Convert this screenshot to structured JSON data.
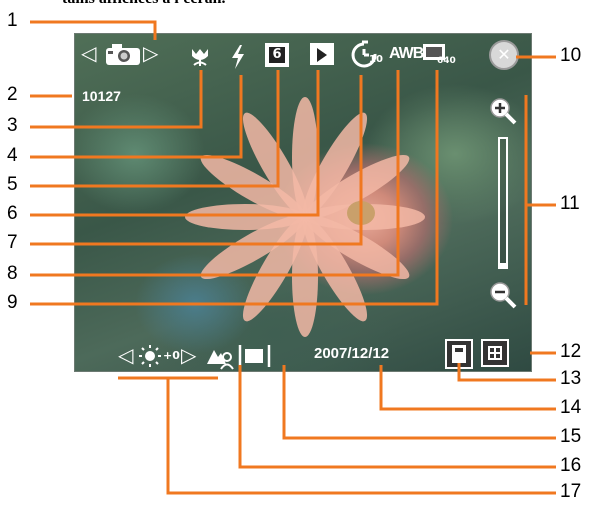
{
  "header": {
    "caption": "tains affichées à l'écran."
  },
  "screen": {
    "shot_counter": "10127",
    "white_balance": "AWB",
    "resolution": "640",
    "self_timer": "10",
    "burst_count": "6",
    "exposure_value": "+0",
    "date": "2007/12/12",
    "close_symbol": "✕"
  },
  "callouts": [
    "1",
    "2",
    "3",
    "4",
    "5",
    "6",
    "7",
    "8",
    "9",
    "10",
    "11",
    "12",
    "13",
    "14",
    "15",
    "16",
    "17"
  ],
  "colors": {
    "callout": "#f07820",
    "overlay_text": "#ffffff"
  }
}
